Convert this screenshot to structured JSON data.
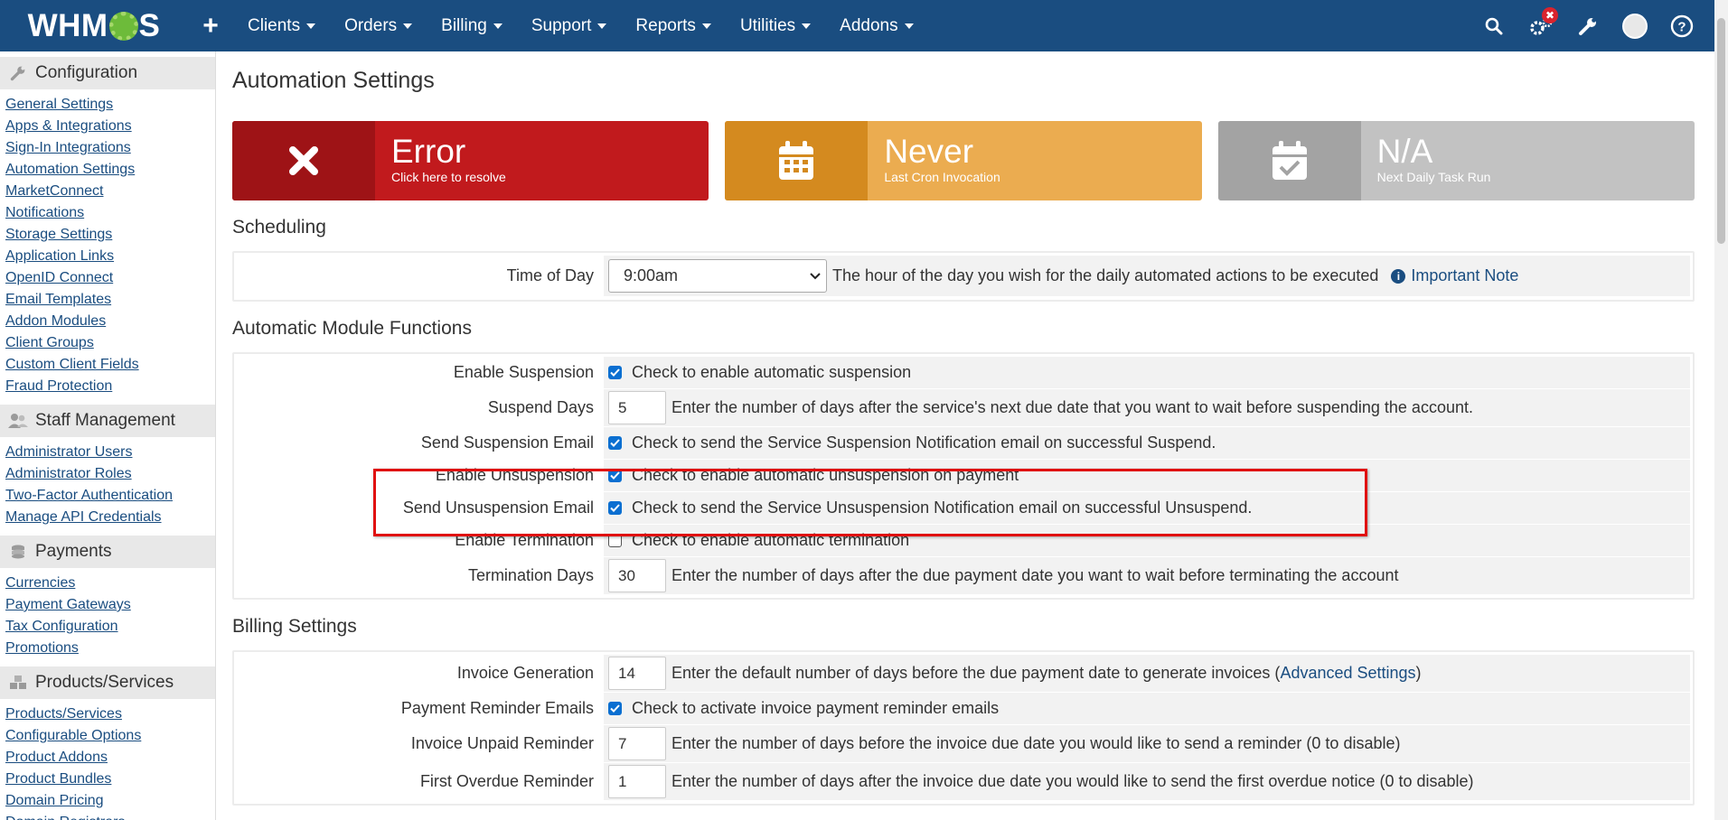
{
  "brand": {
    "logo_left": "WHM",
    "logo_right": "S",
    "plus": "+"
  },
  "nav": {
    "items": [
      "Clients",
      "Orders",
      "Billing",
      "Support",
      "Reports",
      "Utilities",
      "Addons"
    ],
    "badge": "✖"
  },
  "sidebar": {
    "sections": [
      {
        "title": "Configuration",
        "icon": "wrench-icon",
        "links": [
          "General Settings",
          "Apps & Integrations",
          "Sign-In Integrations",
          "Automation Settings",
          "MarketConnect",
          "Notifications",
          "Storage Settings",
          "Application Links",
          "OpenID Connect",
          "Email Templates",
          "Addon Modules",
          "Client Groups",
          "Custom Client Fields",
          "Fraud Protection"
        ]
      },
      {
        "title": "Staff Management",
        "icon": "users-icon",
        "links": [
          "Administrator Users",
          "Administrator Roles",
          "Two-Factor Authentication",
          "Manage API Credentials"
        ]
      },
      {
        "title": "Payments",
        "icon": "coins-icon",
        "links": [
          "Currencies",
          "Payment Gateways",
          "Tax Configuration",
          "Promotions"
        ]
      },
      {
        "title": "Products/Services",
        "icon": "cubes-icon",
        "links": [
          "Products/Services",
          "Configurable Options",
          "Product Addons",
          "Product Bundles",
          "Domain Pricing",
          "Domain Registrars"
        ]
      }
    ]
  },
  "page": {
    "title": "Automation Settings"
  },
  "stats": [
    {
      "big": "Error",
      "small": "Click here to resolve",
      "icon": "close-icon",
      "dark": "#9e1316",
      "light": "#c11a1d"
    },
    {
      "big": "Never",
      "small": "Last Cron Invocation",
      "icon": "calendar-icon",
      "dark": "#d48a1f",
      "light": "#ebac50"
    },
    {
      "big": "N/A",
      "small": "Next Daily Task Run",
      "icon": "calendar-check-icon",
      "dark": "#a3a3a3",
      "light": "#c2c2c2"
    }
  ],
  "scheduling": {
    "title": "Scheduling",
    "time_label": "Time of Day",
    "time_value": "9:00am",
    "time_desc": "The hour of the day you wish for the daily automated actions to be executed",
    "note": "Important Note"
  },
  "module": {
    "title": "Automatic Module Functions",
    "enable_suspension": {
      "label": "Enable Suspension",
      "desc": "Check to enable automatic suspension"
    },
    "suspend_days": {
      "label": "Suspend Days",
      "value": "5",
      "desc": "Enter the number of days after the service's next due date that you want to wait before suspending the account."
    },
    "send_suspension": {
      "label": "Send Suspension Email",
      "desc": "Check to send the Service Suspension Notification email on successful Suspend."
    },
    "enable_unsuspension": {
      "label": "Enable Unsuspension",
      "desc": "Check to enable automatic unsuspension on payment"
    },
    "send_unsuspension": {
      "label": "Send Unsuspension Email",
      "desc": "Check to send the Service Unsuspension Notification email on successful Unsuspend."
    },
    "enable_termination": {
      "label": "Enable Termination",
      "desc": "Check to enable automatic termination"
    },
    "termination_days": {
      "label": "Termination Days",
      "value": "30",
      "desc": "Enter the number of days after the due payment date you want to wait before terminating the account"
    }
  },
  "billing": {
    "title": "Billing Settings",
    "invoice_generation": {
      "label": "Invoice Generation",
      "value": "14",
      "desc": "Enter the default number of days before the due payment date to generate invoices (",
      "link": "Advanced Settings",
      "desc_end": ")"
    },
    "payment_reminder": {
      "label": "Payment Reminder Emails",
      "desc": "Check to activate invoice payment reminder emails"
    },
    "unpaid_reminder": {
      "label": "Invoice Unpaid Reminder",
      "value": "7",
      "desc": "Enter the number of days before the invoice due date you would like to send a reminder (0 to disable)"
    },
    "first_overdue": {
      "label": "First Overdue Reminder",
      "value": "1",
      "desc": "Enter the number of days after the invoice due date you would like to send the first overdue notice (0 to disable)"
    }
  }
}
